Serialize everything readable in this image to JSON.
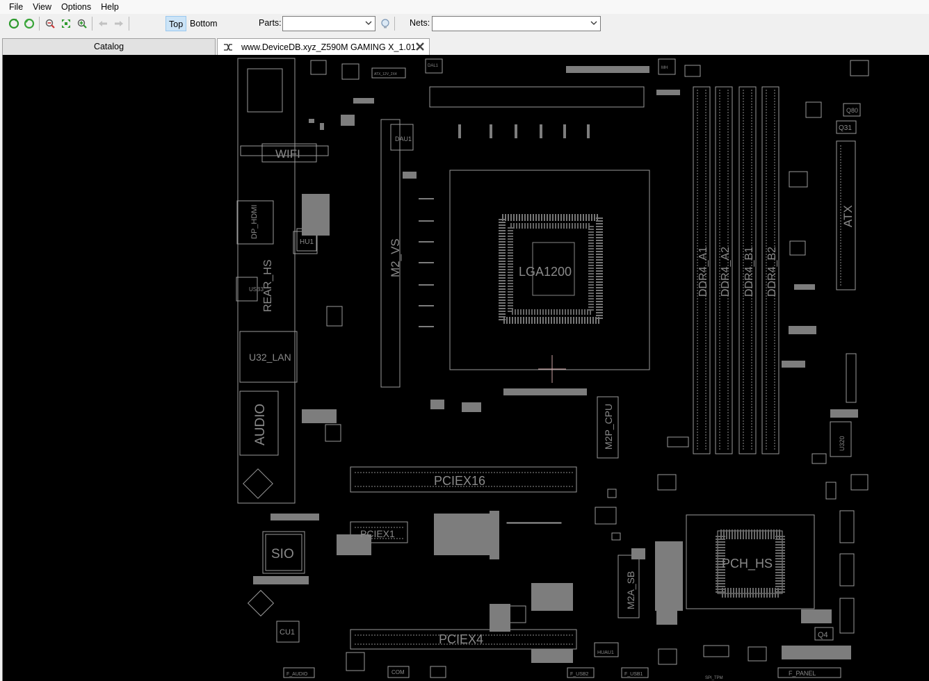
{
  "menu": {
    "file": "File",
    "view": "View",
    "options": "Options",
    "help": "Help"
  },
  "toolbar": {
    "top_label": "Top",
    "bottom_label": "Bottom",
    "parts_label": "Parts:",
    "parts_value": "",
    "nets_label": "Nets:",
    "nets_value": ""
  },
  "tabs": {
    "catalog": "Catalog",
    "board": "www.DeviceDB.xyz_Z590M GAMING X_1.01"
  },
  "board": {
    "wifi": "WIFI",
    "dp_hdmi": "DP_HDMI",
    "hu1": "HU1",
    "usb3": "USB3",
    "rear_hs": "REAR_HS",
    "u32_lan": "U32_LAN",
    "audio": "AUDIO",
    "sio": "SIO",
    "cu1": "CU1",
    "dau1": "DAU1",
    "m2_vs": "M2_VS",
    "lga": "LGA1200",
    "ddr4_a1": "DDR4_A1",
    "ddr4_a2": "DDR4_A2",
    "ddr4_b1": "DDR4_B1",
    "ddr4_b2": "DDR4_B2",
    "atx": "ATX",
    "q80": "Q80",
    "q31": "Q31",
    "m2p_cpu": "M2P_CPU",
    "pciex16": "PCIEX16",
    "pciex1": "PCIEX1",
    "pciex4": "PCIEX4",
    "pch": "PCH_HS",
    "m2a_sb": "M2A_SB",
    "q4": "Q4",
    "u320": "U320",
    "f_audio": "F_AUDIO",
    "com": "COM",
    "f_usb2": "F_USB2",
    "f_usb1": "F_USB1",
    "f_panel": "F_PANEL",
    "spi": "SPI_TPM",
    "mh": "MH",
    "huau1": "HUAU1",
    "dal1": "DAL1",
    "atx_12v": "ATX_12V_2X4"
  },
  "colors": {
    "canvas": "#000000",
    "outline": "#9a9a9a",
    "label": "#8a8a8a",
    "active_side": "#cce4f7"
  },
  "icons": [
    "refresh-icon",
    "reload-icon",
    "zoom-out-icon",
    "fit-icon",
    "zoom-in-icon",
    "back-arrow-icon",
    "forward-arrow-icon",
    "search-bulb-icon",
    "tab-swap-icon",
    "close-icon",
    "chevron-down-icon"
  ]
}
